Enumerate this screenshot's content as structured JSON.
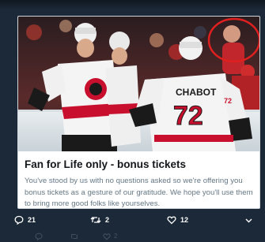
{
  "card": {
    "title": "Fan for Life only - bonus tickets",
    "description": "You've stood by us with no questions asked so we're offering you bonus tickets as a gesture of our gratitude. We hope you'll use them to bring more good folks like yourselves.",
    "image": {
      "jersey_name": "CHABOT",
      "jersey_number": "72",
      "sleeve_number": "72"
    }
  },
  "actions": {
    "replies": "21",
    "retweets": "2",
    "likes": "12"
  },
  "faded_row": {
    "retweets": "2"
  },
  "colors": {
    "background": "#1c2938",
    "jersey_white": "#f4f4f4",
    "jersey_red": "#c8102e",
    "highlight_circle": "#e0201f",
    "title_text": "#14171a",
    "desc_text": "#657786"
  },
  "icons": [
    "reply-icon",
    "retweet-icon",
    "like-icon",
    "share-icon"
  ]
}
